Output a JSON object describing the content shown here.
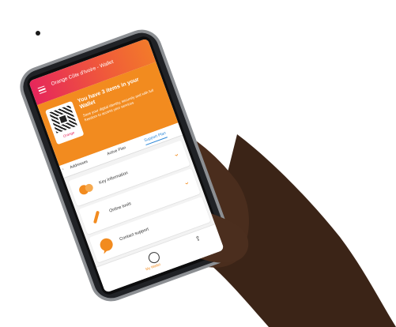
{
  "app": {
    "title": "Orange Côte d'Ivoire - Wallet",
    "accent_color": "#f28b1f",
    "brand_color": "#e6265b"
  },
  "hero": {
    "headline": "You have 3 items in your Wallet",
    "subtitle": "Save your digital identity, securely and with full freedom to access your services",
    "qr_label": "Orange"
  },
  "tabs": [
    {
      "label": "Addresses",
      "active": false
    },
    {
      "label": "Active Plan",
      "active": false
    },
    {
      "label": "Support Plan",
      "active": true
    }
  ],
  "list": [
    {
      "label": "Key Information",
      "icon": "shield-icon"
    },
    {
      "label": "Online tools",
      "icon": "tools-icon"
    },
    {
      "label": "Contact support",
      "icon": "chat-bubble-icon"
    }
  ],
  "bottom_nav": {
    "label": "My Wallet",
    "icon": "profile-icon"
  }
}
